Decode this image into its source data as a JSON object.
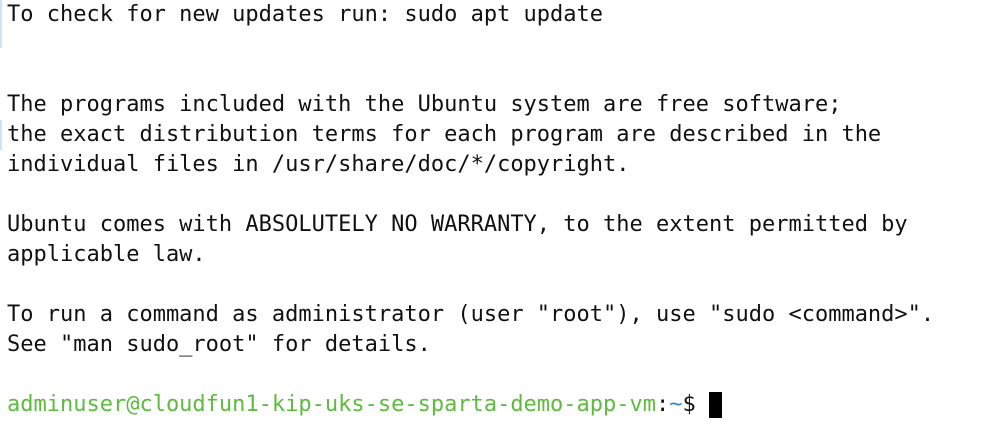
{
  "terminal": {
    "lines": [
      "To check for new updates run: sudo apt update",
      "",
      "",
      "The programs included with the Ubuntu system are free software;",
      "the exact distribution terms for each program are described in the",
      "individual files in /usr/share/doc/*/copyright.",
      "",
      "Ubuntu comes with ABSOLUTELY NO WARRANTY, to the extent permitted by",
      "applicable law.",
      "",
      "To run a command as administrator (user \"root\"), use \"sudo <command>\".",
      "See \"man sudo_root\" for details.",
      ""
    ],
    "prompt": {
      "user_host": "adminuser@cloudfun1-kip-uks-se-sparta-demo-app-vm",
      "separator": ":",
      "path": "~",
      "symbol": "$ "
    }
  },
  "colors": {
    "user_host": "#5dbb3f",
    "path": "#3d86c8",
    "text": "#111111",
    "background": "#ffffff"
  }
}
